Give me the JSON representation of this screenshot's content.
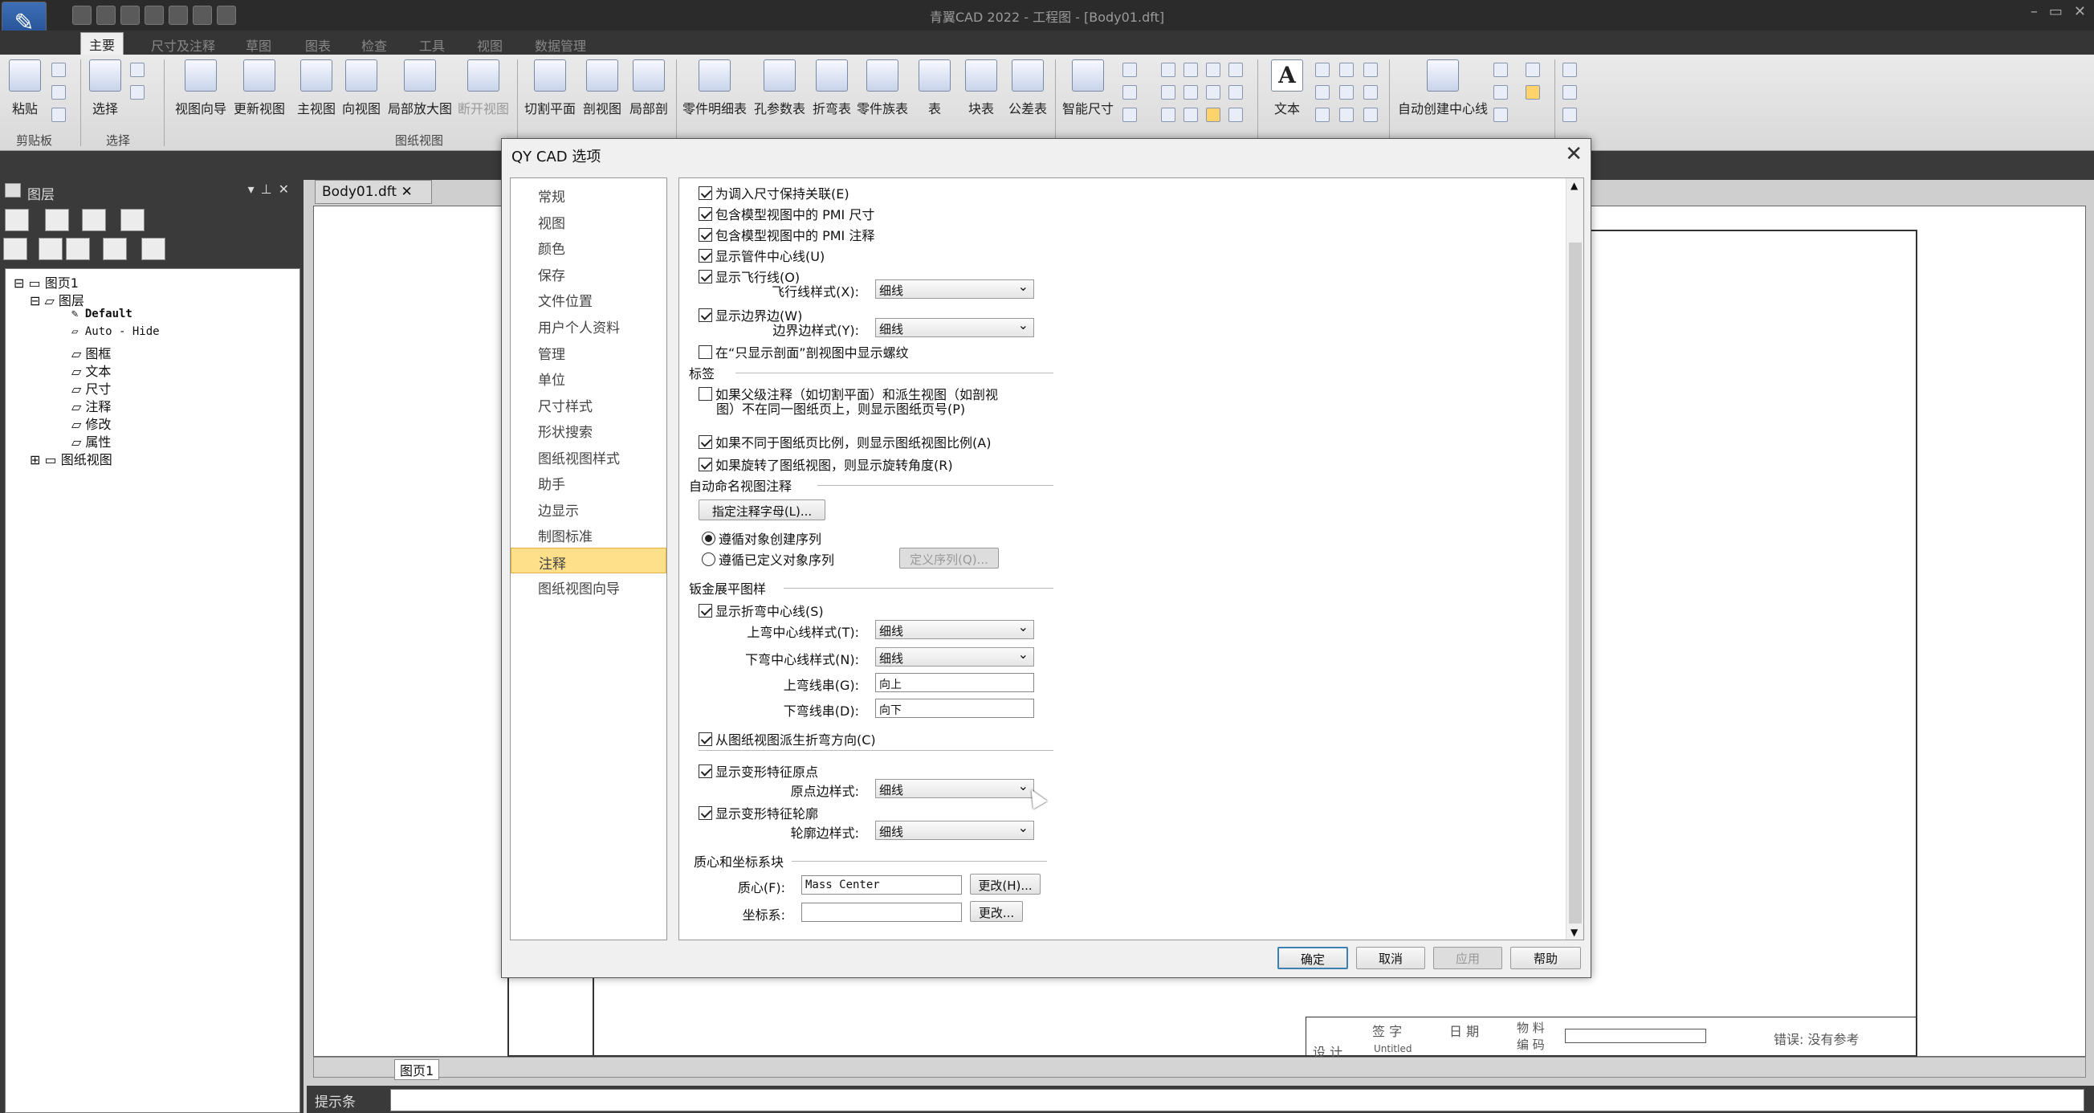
{
  "window": {
    "title": "青翼CAD 2022 - 工程图 - [Body01.dft]",
    "controls": [
      "–",
      "▭",
      "✕"
    ]
  },
  "menu": [
    "主要",
    "尺寸及注释",
    "草图",
    "图表",
    "检查",
    "工具",
    "视图",
    "数据管理"
  ],
  "ribbon": {
    "buttons": [
      "粘贴",
      "选择",
      "视图向导",
      "更新视图",
      "主视图",
      "向视图",
      "局部放大图",
      "断开视图",
      "切割平面",
      "剖视图",
      "局部剖",
      "零件明细表",
      "孔参数表",
      "折弯表",
      "零件族表",
      "表",
      "块表",
      "公差表",
      "智能尺寸",
      "文本",
      "自动创建中心线"
    ],
    "groups": [
      "剪贴板",
      "选择",
      "图纸视图"
    ]
  },
  "layers_panel": {
    "title": "图层",
    "tree": [
      {
        "label": "图页1",
        "depth": 0
      },
      {
        "label": "图层",
        "depth": 1
      },
      {
        "label": "Default",
        "depth": 2
      },
      {
        "label": "Auto - Hide",
        "depth": 2
      },
      {
        "label": "图框",
        "depth": 2
      },
      {
        "label": "文本",
        "depth": 2
      },
      {
        "label": "尺寸",
        "depth": 2
      },
      {
        "label": "注释",
        "depth": 2
      },
      {
        "label": "修改",
        "depth": 2
      },
      {
        "label": "属性",
        "depth": 2
      },
      {
        "label": "图纸视图",
        "depth": 1
      }
    ]
  },
  "document_tab": "Body01.dft",
  "sheet_tab": "图页1",
  "hint_label": "提示条",
  "titleblock": {
    "sign": "签  字",
    "date": "日  期",
    "design": "设  计",
    "material_code": "物 料 编 码",
    "error": "错误: 没有参考",
    "sig_value": "Untitled"
  },
  "dialog": {
    "title": "QY CAD 选项",
    "nav": [
      "常规",
      "视图",
      "颜色",
      "保存",
      "文件位置",
      "用户个人资料",
      "管理",
      "单位",
      "尺寸样式",
      "形状搜索",
      "图纸视图样式",
      "助手",
      "边显示",
      "制图标准",
      "注释",
      "图纸视图向导"
    ],
    "selected_nav": "注释",
    "options": {
      "keep_dim_assoc": "为调入尺寸保持关联(E)",
      "pmi_dims": "包含模型视图中的 PMI 尺寸",
      "pmi_notes": "包含模型视图中的 PMI 注释",
      "pipe_centerline": "显示管件中心线(U)",
      "flyline": "显示飞行线(O)",
      "flyline_style_label": "飞行线样式(X):",
      "flyline_style": "细线",
      "boundary": "显示边界边(W)",
      "boundary_style_label": "边界边样式(Y):",
      "boundary_style": "细线",
      "section_threads": "在“只显示剖面”剖视图中显示螺纹",
      "label_section": "标签",
      "parent_note_1": "如果父级注释（如切割平面）和派生视图（如剖视",
      "parent_note_2": "图）不在同一图纸页上，则显示图纸页号(P)",
      "scale_diff": "如果不同于图纸页比例，则显示图纸视图比例(A)",
      "rotated": "如果旋转了图纸视图，则显示旋转角度(R)",
      "autoname_section": "自动命名视图注释",
      "specify_letters_btn": "指定注释字母(L)...",
      "follow_creation": "遵循对象创建序列",
      "follow_defined": "遵循已定义对象序列",
      "define_seq_btn": "定义序列(Q)...",
      "flat_section": "钣金展平图样",
      "bend_centerline": "显示折弯中心线(S)",
      "bend_up_style_label": "上弯中心线样式(T):",
      "bend_up_style": "细线",
      "bend_down_style_label": "下弯中心线样式(N):",
      "bend_down_style": "细线",
      "bend_up_str_label": "上弯线串(G):",
      "bend_up_str": "向上",
      "bend_down_str_label": "下弯线串(D):",
      "bend_down_str": "向下",
      "derive_bend": "从图纸视图派生折弯方向(C)",
      "deform_origin": "显示变形特征原点",
      "origin_style_label": "原点边样式:",
      "origin_style": "细线",
      "deform_outline": "显示变形特征轮廓",
      "outline_style_label": "轮廓边样式:",
      "outline_style": "细线",
      "mass_section": "质心和坐标系块",
      "mass_label": "质心(F):",
      "mass_value": "Mass Center",
      "mass_change_btn": "更改(H)...",
      "coord_label": "坐标系:",
      "coord_value": "",
      "coord_change_btn": "更改..."
    },
    "buttons": {
      "ok": "确定",
      "cancel": "取消",
      "apply": "应用",
      "help": "帮助"
    }
  }
}
